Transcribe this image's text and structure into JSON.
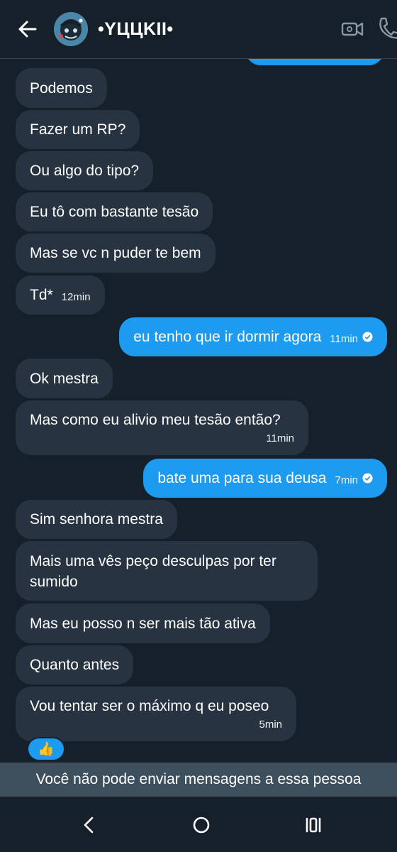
{
  "header": {
    "contact_name": "•YЦЦKII•"
  },
  "messages": [
    {
      "dir": "in",
      "text": "Podemos"
    },
    {
      "dir": "in",
      "text": "Fazer um RP?"
    },
    {
      "dir": "in",
      "text": "Ou algo do tipo?"
    },
    {
      "dir": "in",
      "text": "Eu tô com bastante tesão"
    },
    {
      "dir": "in",
      "text": "Mas se vc n puder te bem"
    },
    {
      "dir": "in",
      "text": "Td*",
      "time": "12min"
    },
    {
      "dir": "out",
      "text": "eu tenho que ir dormir agora",
      "time": "11min",
      "seen": true
    },
    {
      "dir": "in",
      "text": "Ok mestra"
    },
    {
      "dir": "in",
      "text": "Mas como eu alivio meu tesão então?",
      "time": "11min"
    },
    {
      "dir": "out",
      "text": "bate uma para sua deusa",
      "time": "7min",
      "seen": true
    },
    {
      "dir": "in",
      "text": "Sim senhora mestra"
    },
    {
      "dir": "in",
      "text": "Mais uma vês peço desculpas por ter sumido"
    },
    {
      "dir": "in",
      "text": "Mas eu posso n ser mais tão ativa"
    },
    {
      "dir": "in",
      "text": "Quanto antes"
    },
    {
      "dir": "in",
      "text": "Vou tentar ser o máximo q eu poseo",
      "time": "5min",
      "reaction": "👍"
    }
  ],
  "notice": "Você não pode enviar mensagens a essa pessoa",
  "colors": {
    "background": "#15202b",
    "incoming_bubble": "#273340",
    "outgoing_bubble": "#1d9bf0",
    "notice_bar": "#3d4f5c"
  },
  "icons": {
    "back": "arrow-left-icon",
    "video": "video-camera-icon",
    "phone": "phone-icon",
    "reaction": "thumbs-up-icon",
    "nav_back": "chevron-left-icon",
    "nav_home": "circle-home-icon",
    "nav_recents": "recents-icon"
  }
}
